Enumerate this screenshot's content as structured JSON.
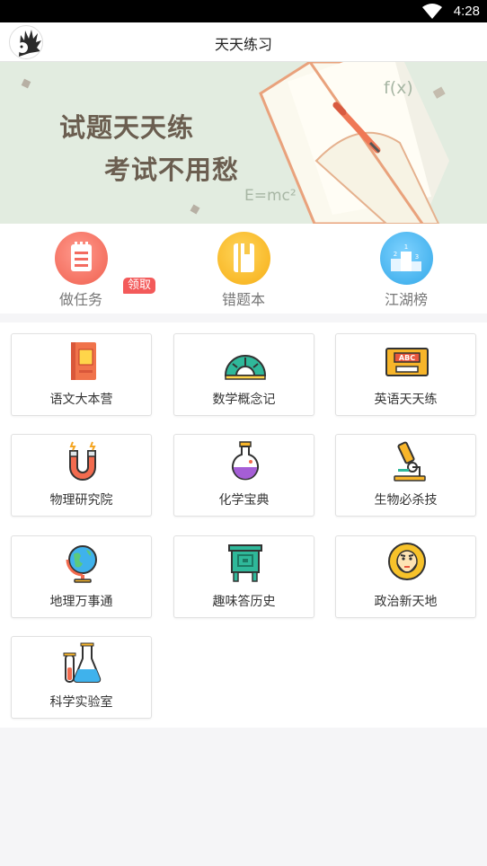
{
  "status_bar": {
    "time": "4:28"
  },
  "app_bar": {
    "title": "天天练习"
  },
  "banner": {
    "line1": "试题天天练",
    "line2": "考试不用愁",
    "formula_fx": "f(x)",
    "formula_emc": "E=mc²"
  },
  "quick_actions": [
    {
      "label": "做任务",
      "icon": "task-list-icon",
      "badge": "领取",
      "color": "#f36b60"
    },
    {
      "label": "错题本",
      "icon": "notebook-icon",
      "color": "#f8b81f"
    },
    {
      "label": "江湖榜",
      "icon": "podium-icon",
      "color": "#3fb2ec"
    }
  ],
  "subjects": [
    {
      "label": "语文大本营",
      "icon": "chinese-book-icon"
    },
    {
      "label": "数学概念记",
      "icon": "protractor-icon"
    },
    {
      "label": "英语天天练",
      "icon": "abc-cassette-icon"
    },
    {
      "label": "物理研究院",
      "icon": "magnet-icon"
    },
    {
      "label": "化学宝典",
      "icon": "potion-flask-icon"
    },
    {
      "label": "生物必杀技",
      "icon": "microscope-icon"
    },
    {
      "label": "地理万事通",
      "icon": "globe-icon"
    },
    {
      "label": "趣味答历史",
      "icon": "bronze-ding-icon"
    },
    {
      "label": "政治新天地",
      "icon": "philosopher-icon"
    },
    {
      "label": "科学实验室",
      "icon": "lab-flasks-icon"
    }
  ]
}
